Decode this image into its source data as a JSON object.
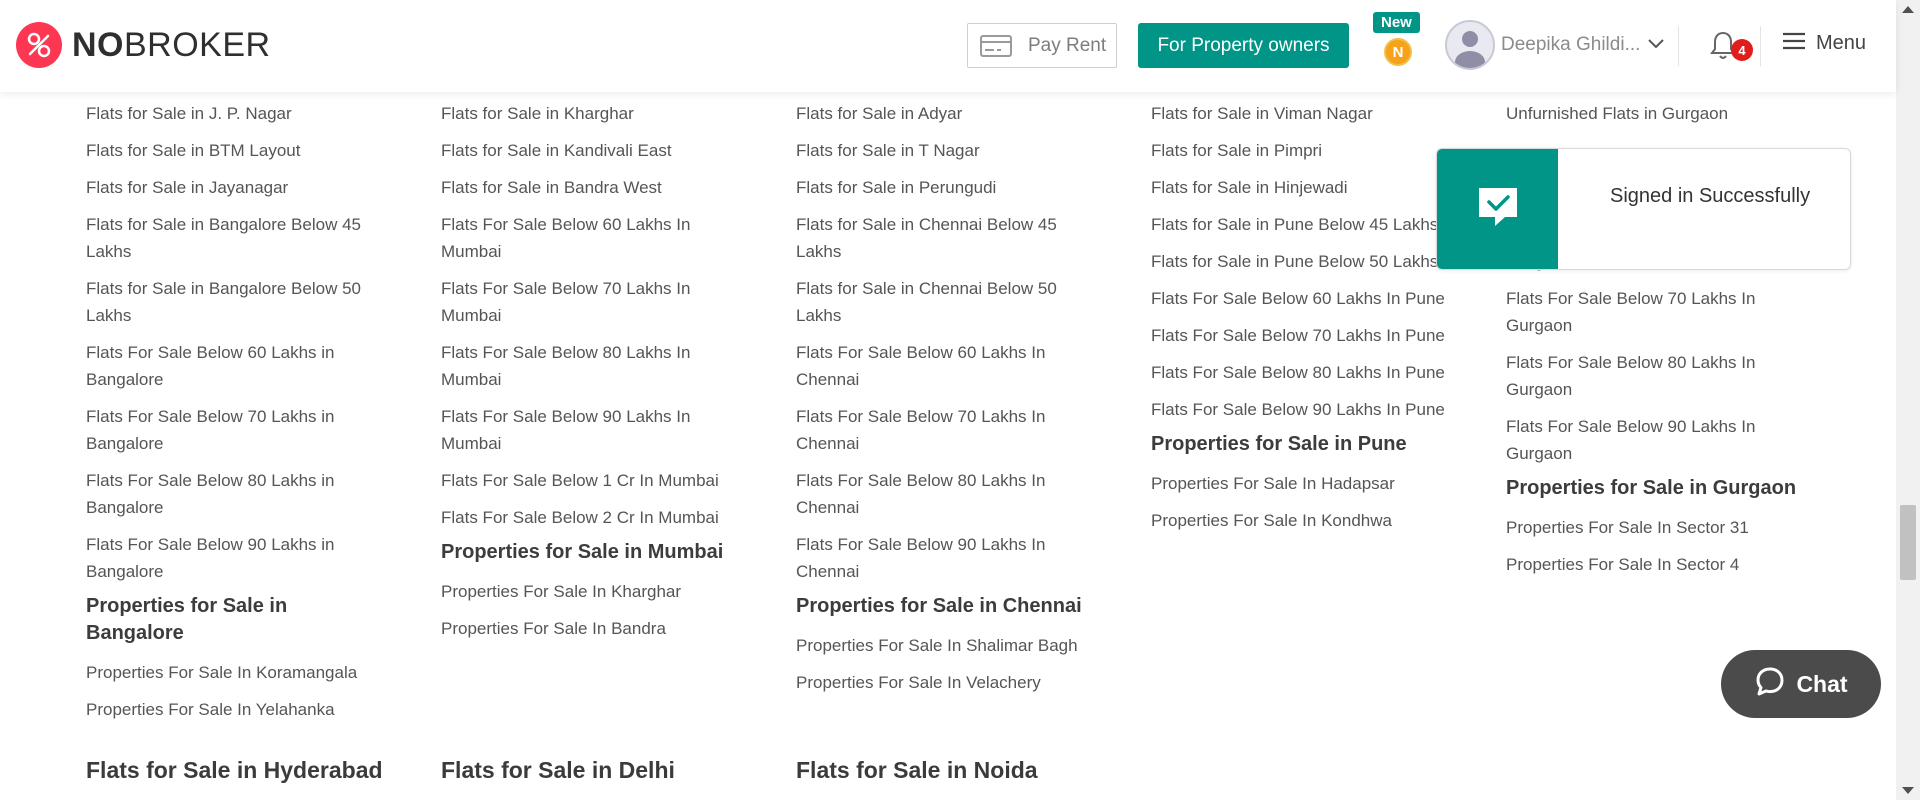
{
  "header": {
    "logo": {
      "no": "NO",
      "broker": "BROKER"
    },
    "pay_rent": "Pay Rent",
    "owners_button": "For Property owners",
    "new_badge": "New",
    "coin_letter": "N",
    "user_name": "Deepika Ghildi...",
    "notification_count": "4",
    "menu_label": "Menu"
  },
  "columns": [
    {
      "links_top": [
        "Flats for Sale in J. P. Nagar",
        "Flats for Sale in BTM Layout",
        "Flats for Sale in Jayanagar",
        "Flats for Sale in Bangalore Below 45 Lakhs",
        "Flats for Sale in Bangalore Below 50 Lakhs",
        "Flats For Sale Below 60 Lakhs in Bangalore",
        "Flats For Sale Below 70 Lakhs in Bangalore",
        "Flats For Sale Below 80 Lakhs in Bangalore",
        "Flats For Sale Below 90 Lakhs in Bangalore"
      ],
      "heading": "Properties for Sale in Bangalore",
      "links_bottom": [
        "Properties For Sale In Koramangala",
        "Properties For Sale In Yelahanka"
      ]
    },
    {
      "links_top": [
        "Flats for Sale in Kharghar",
        "Flats for Sale in Kandivali East",
        "Flats for Sale in Bandra West",
        "Flats For Sale Below 60 Lakhs In Mumbai",
        "Flats For Sale Below 70 Lakhs In Mumbai",
        "Flats For Sale Below 80 Lakhs In Mumbai",
        "Flats For Sale Below 90 Lakhs In Mumbai",
        "Flats For Sale Below 1 Cr In Mumbai",
        "Flats For Sale Below 2 Cr In Mumbai"
      ],
      "heading": "Properties for Sale in Mumbai",
      "links_bottom": [
        "Properties For Sale In Kharghar",
        "Properties For Sale In Bandra"
      ]
    },
    {
      "links_top": [
        "Flats for Sale in Adyar",
        "Flats for Sale in T Nagar",
        "Flats for Sale in Perungudi",
        "Flats for Sale in Chennai Below 45 Lakhs",
        "Flats for Sale in Chennai Below 50 Lakhs",
        "Flats For Sale Below 60 Lakhs In Chennai",
        "Flats For Sale Below 70 Lakhs In Chennai",
        "Flats For Sale Below 80 Lakhs In Chennai",
        "Flats For Sale Below 90 Lakhs In Chennai"
      ],
      "heading": "Properties for Sale in Chennai",
      "links_bottom": [
        "Properties For Sale In Shalimar Bagh",
        "Properties For Sale In Velachery"
      ]
    },
    {
      "links_top": [
        "Flats for Sale in Viman Nagar",
        "Flats for Sale in Pimpri",
        "Flats for Sale in Hinjewadi",
        "Flats for Sale in Pune Below 45 Lakhs",
        "Flats for Sale in Pune Below 50 Lakhs",
        "Flats For Sale Below 60 Lakhs In Pune",
        "Flats For Sale Below 70 Lakhs In Pune",
        "Flats For Sale Below 80 Lakhs In Pune",
        "Flats For Sale Below 90 Lakhs In Pune"
      ],
      "heading": "Properties for Sale in Pune",
      "links_bottom": [
        "Properties For Sale In Hadapsar",
        "Properties For Sale In Kondhwa"
      ]
    },
    {
      "links_top": [
        "Unfurnished Flats in Gurgaon",
        "",
        "",
        "",
        "Gurgaon",
        "Flats For Sale Below 70 Lakhs In Gurgaon",
        "Flats For Sale Below 80 Lakhs In Gurgaon",
        "Flats For Sale Below 90 Lakhs In Gurgaon"
      ],
      "heading": "Properties for Sale in Gurgaon",
      "links_bottom": [
        "Properties For Sale In Sector 31",
        "Properties For Sale In Sector 4"
      ]
    }
  ],
  "bottom_headings": [
    "Flats for Sale in Hyderabad",
    "Flats for Sale in Delhi",
    "Flats for Sale in Noida"
  ],
  "toast": {
    "message": "Signed in Successfully"
  },
  "chat": {
    "label": "Chat"
  },
  "colors": {
    "brand_red": "#fd3752",
    "teal": "#009587",
    "chat_bg": "#4b4b4b"
  }
}
